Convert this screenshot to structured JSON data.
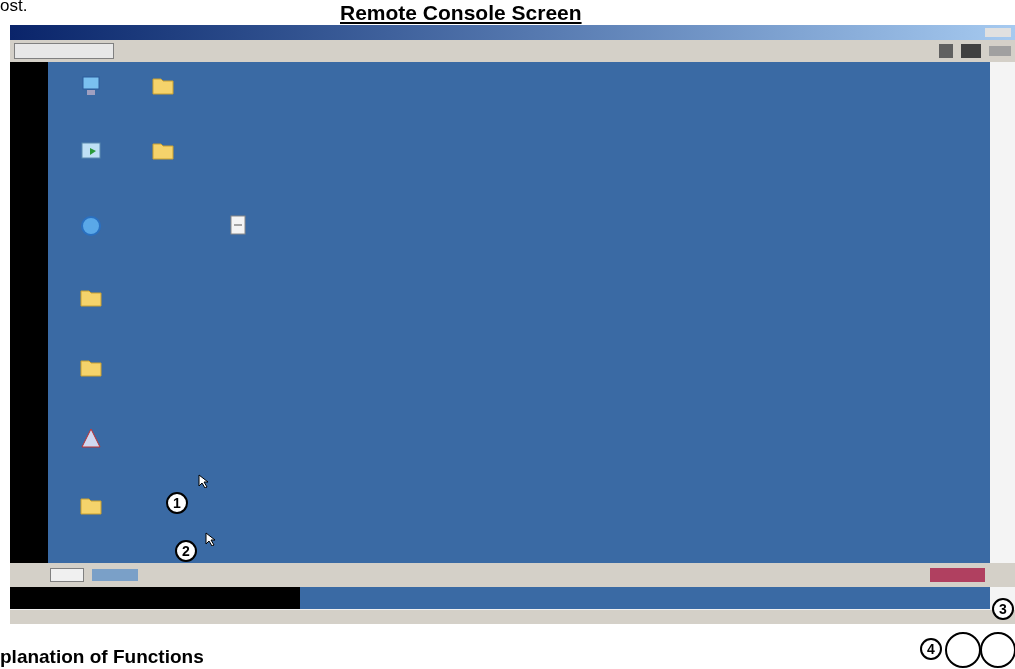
{
  "page": {
    "top_text": "ost.",
    "title": "Remote Console Screen",
    "next_heading": "planation of Functions"
  },
  "desktop_icons": [
    {
      "kind": "computer"
    },
    {
      "kind": "folder"
    },
    {
      "kind": "network"
    },
    {
      "kind": "folder"
    },
    {
      "kind": "globe"
    },
    {
      "kind": "notepad"
    },
    {
      "kind": "folder"
    },
    {
      "kind": "folder"
    },
    {
      "kind": "program"
    },
    {
      "kind": "folder"
    }
  ],
  "callouts": [
    {
      "number": "1"
    },
    {
      "number": "2"
    },
    {
      "number": "3"
    },
    {
      "number": "4"
    }
  ]
}
